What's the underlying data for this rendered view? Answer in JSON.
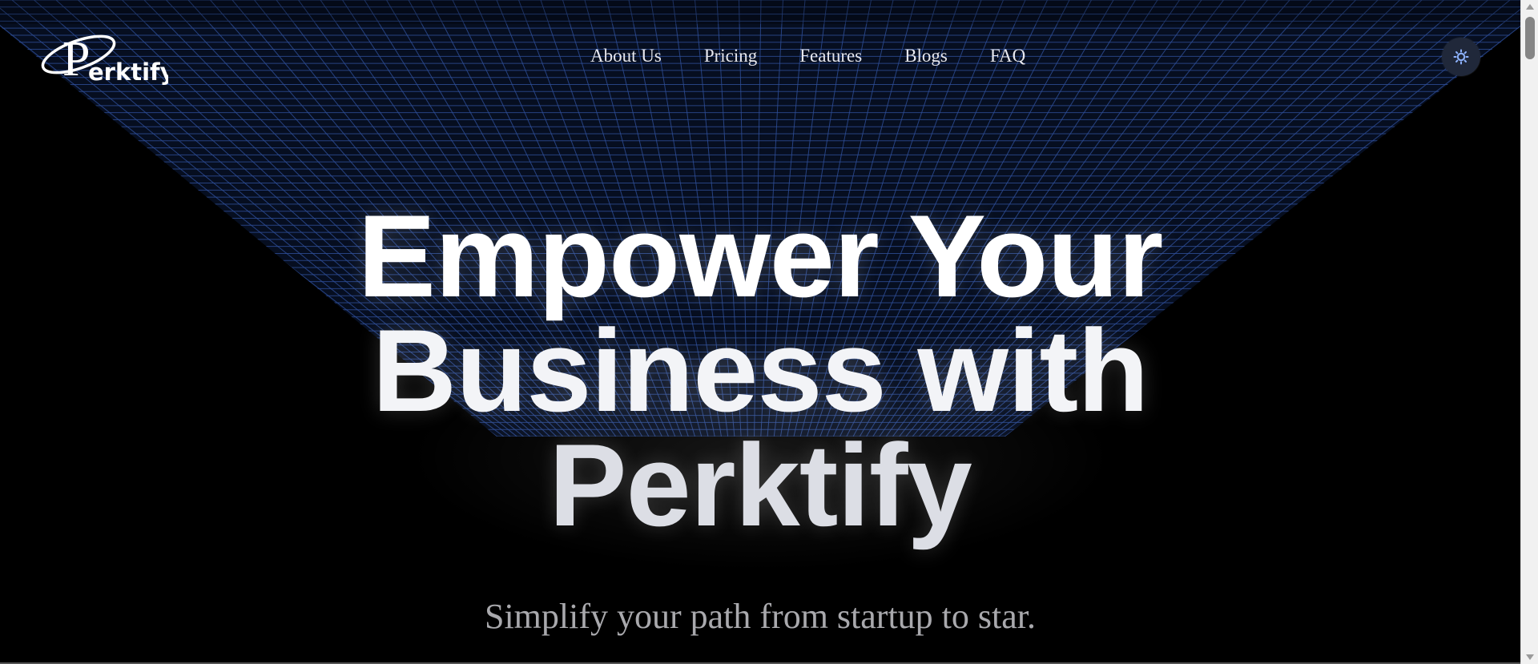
{
  "brand": {
    "name": "Perktify",
    "logo_initial": "P",
    "logo_rest": "erktify"
  },
  "nav": {
    "items": [
      {
        "label": "About Us"
      },
      {
        "label": "Pricing"
      },
      {
        "label": "Features"
      },
      {
        "label": "Blogs"
      },
      {
        "label": "FAQ"
      }
    ]
  },
  "theme_toggle": {
    "icon": "sun-icon"
  },
  "hero": {
    "title_lines": [
      "Empower Your",
      "Business with",
      "Perktify"
    ],
    "subtitle": "Simplify your path from startup to star."
  },
  "colors": {
    "background": "#000000",
    "grid_line": "#2f4f9a",
    "toggle_bg": "#20283a",
    "toggle_icon": "#8fb4ff",
    "subtitle": "#a9a9ad"
  }
}
